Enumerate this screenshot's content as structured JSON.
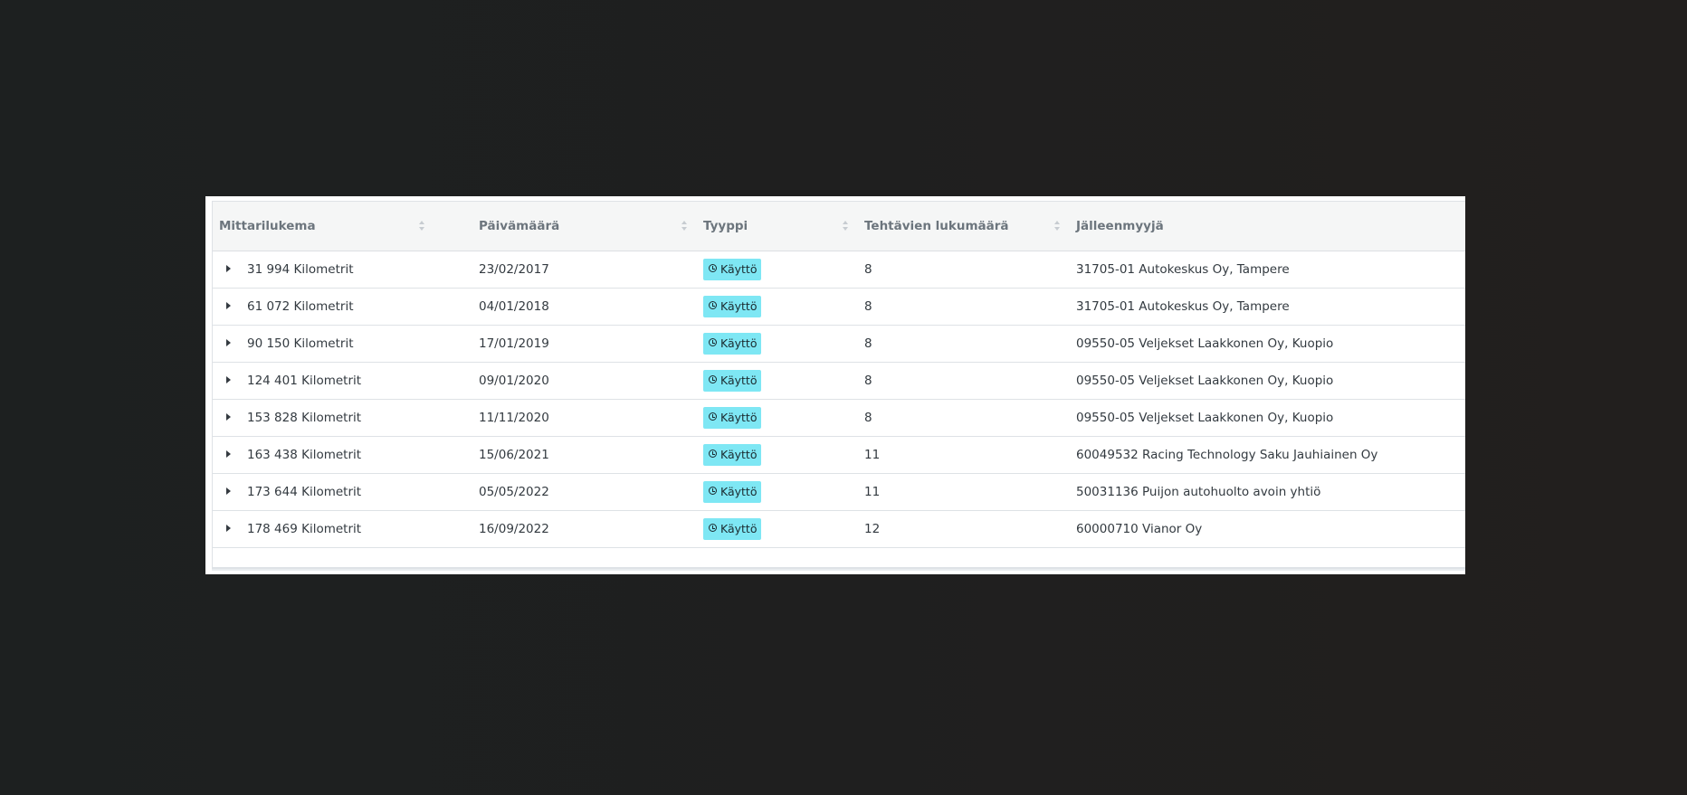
{
  "table": {
    "columns": [
      {
        "key": "mileage",
        "label": "Mittarilukema",
        "sortable": true
      },
      {
        "key": "date",
        "label": "Päivämäärä",
        "sortable": true
      },
      {
        "key": "type",
        "label": "Tyyppi",
        "sortable": true
      },
      {
        "key": "task_count",
        "label": "Tehtävien lukumäärä",
        "sortable": true
      },
      {
        "key": "dealer",
        "label": "Jälleenmyyjä",
        "sortable": false
      }
    ],
    "rows": [
      {
        "mileage": "31 994 Kilometrit",
        "date": "23/02/2017",
        "type": "Käyttö",
        "task_count": "8",
        "dealer": "31705-01 Autokeskus Oy, Tampere"
      },
      {
        "mileage": "61 072 Kilometrit",
        "date": "04/01/2018",
        "type": "Käyttö",
        "task_count": "8",
        "dealer": "31705-01 Autokeskus Oy, Tampere"
      },
      {
        "mileage": "90 150 Kilometrit",
        "date": "17/01/2019",
        "type": "Käyttö",
        "task_count": "8",
        "dealer": "09550-05 Veljekset Laakkonen Oy, Kuopio"
      },
      {
        "mileage": "124 401 Kilometrit",
        "date": "09/01/2020",
        "type": "Käyttö",
        "task_count": "8",
        "dealer": "09550-05 Veljekset Laakkonen Oy, Kuopio"
      },
      {
        "mileage": "153 828 Kilometrit",
        "date": "11/11/2020",
        "type": "Käyttö",
        "task_count": "8",
        "dealer": "09550-05 Veljekset Laakkonen Oy, Kuopio"
      },
      {
        "mileage": "163 438 Kilometrit",
        "date": "15/06/2021",
        "type": "Käyttö",
        "task_count": "11",
        "dealer": "60049532 Racing Technology Saku Jauhiainen Oy"
      },
      {
        "mileage": "173 644 Kilometrit",
        "date": "05/05/2022",
        "type": "Käyttö",
        "task_count": "11",
        "dealer": "50031136 Puijon autohuolto avoin yhtiö"
      },
      {
        "mileage": "178 469 Kilometrit",
        "date": "16/09/2022",
        "type": "Käyttö",
        "task_count": "12",
        "dealer": "60000710 Vianor Oy"
      }
    ]
  },
  "icons": {
    "expand": "caret-right-icon",
    "sort": "sort-icon",
    "type_badge": "clock-icon"
  },
  "colors": {
    "backdrop": "#1f1f1f",
    "header_bg": "#f5f6f6",
    "badge_bg": "#7ee7f4",
    "header_text": "#6c757d",
    "body_text": "#333a40"
  }
}
